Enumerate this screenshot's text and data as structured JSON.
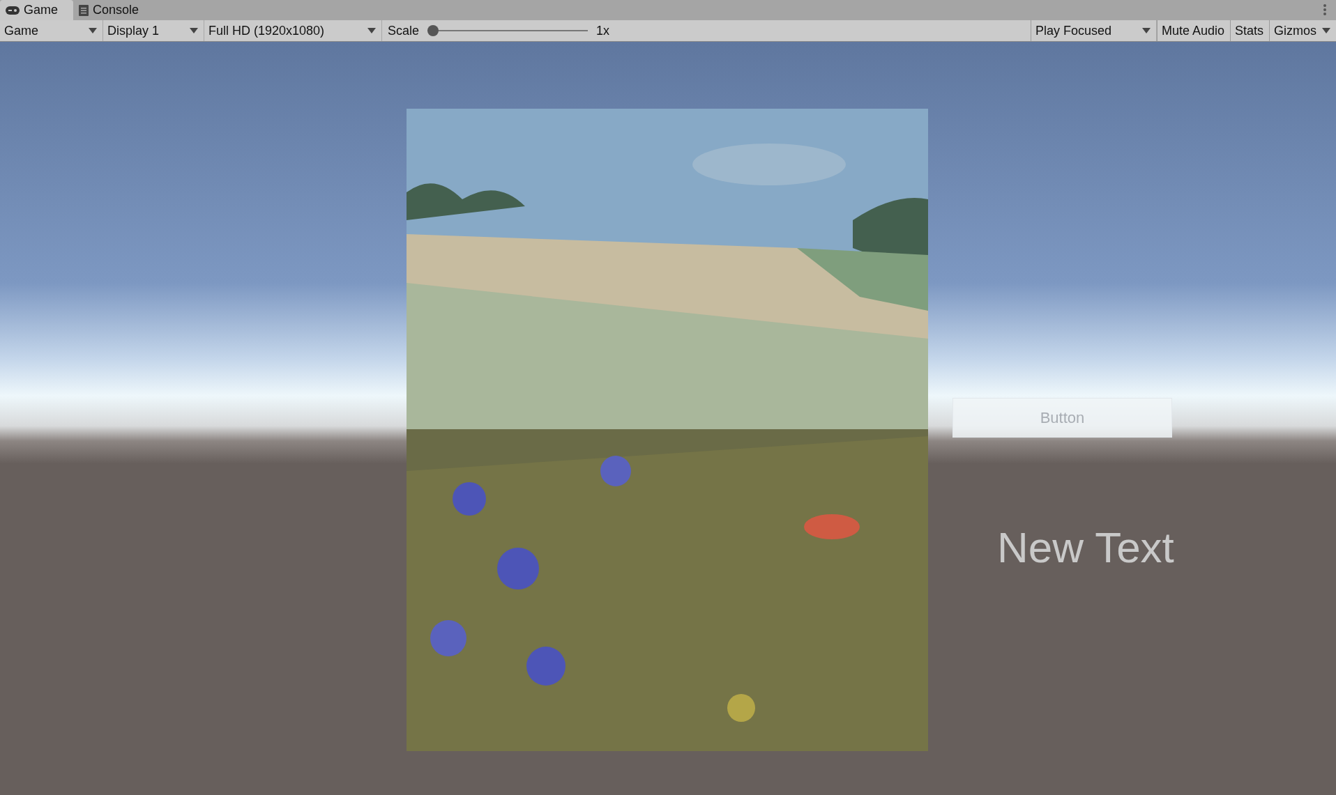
{
  "tabs": [
    {
      "label": "Game",
      "kind": "gamepad",
      "selected": true
    },
    {
      "label": "Console",
      "kind": "console",
      "selected": false
    }
  ],
  "toolbar": {
    "dropdowns": [
      {
        "label": "Game"
      },
      {
        "label": "Display 1"
      },
      {
        "label": "Full HD (1920x1080)"
      }
    ],
    "scale": {
      "label": "Scale",
      "level": 0,
      "reading": "1x"
    },
    "play_mode": {
      "label": "Play Focused"
    },
    "toggles": [
      {
        "label": "Mute Audio",
        "kind": "plain"
      },
      {
        "label": "Stats",
        "kind": "plain"
      },
      {
        "label": "Gizmos",
        "kind": "menu"
      }
    ]
  },
  "game_view": {
    "button": {
      "label": "Button"
    },
    "text": "New Text"
  }
}
